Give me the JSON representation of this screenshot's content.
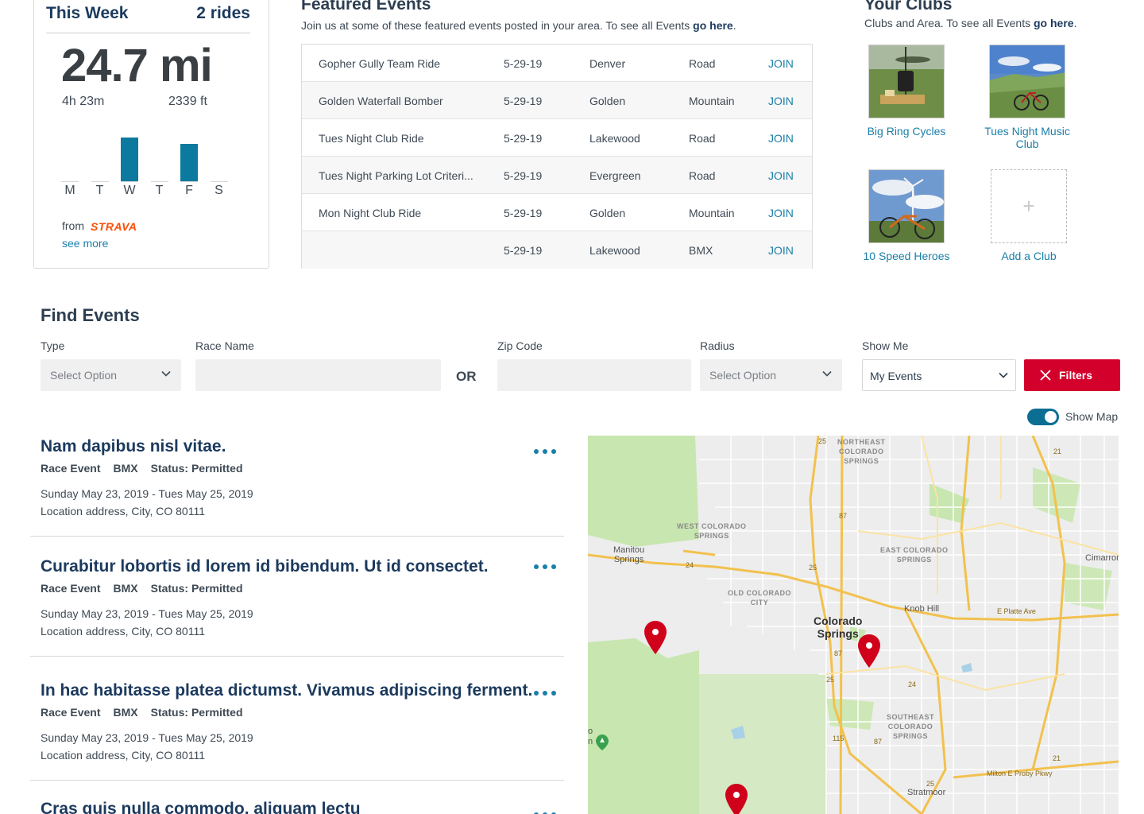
{
  "week": {
    "title": "This Week",
    "rides": "2 rides",
    "distance": "24.7 mi",
    "time": "4h 23m",
    "elevation": "2339 ft",
    "days": [
      {
        "label": "M",
        "level": 0
      },
      {
        "label": "T",
        "level": 0
      },
      {
        "label": "W",
        "level": 1.0
      },
      {
        "label": "T",
        "level": 0
      },
      {
        "label": "F",
        "level": 0.85
      },
      {
        "label": "S",
        "level": 0
      }
    ],
    "from_label": "from",
    "provider": "STRAVA",
    "see_more": "see more"
  },
  "featured": {
    "title": "Featured Events",
    "desc_prefix": "Join us at some of these featured events posted in your area. To see all Events ",
    "desc_link": "go here",
    "desc_suffix": ".",
    "rows": [
      {
        "name": "Gopher Gully Team Ride",
        "date": "5-29-19",
        "city": "Denver",
        "type": "Road",
        "action": "JOIN"
      },
      {
        "name": "Golden Waterfall Bomber",
        "date": "5-29-19",
        "city": "Golden",
        "type": "Mountain",
        "action": "JOIN"
      },
      {
        "name": "Tues Night Club Ride",
        "date": "5-29-19",
        "city": "Lakewood",
        "type": "Road",
        "action": "JOIN"
      },
      {
        "name": "Tues Night Parking Lot Criteri...",
        "date": "5-29-19",
        "city": "Evergreen",
        "type": "Road",
        "action": "JOIN"
      },
      {
        "name": "Mon Night Club Ride",
        "date": "5-29-19",
        "city": "Golden",
        "type": "Mountain",
        "action": "JOIN"
      },
      {
        "name": "",
        "date": "5-29-19",
        "city": "Lakewood",
        "type": "BMX",
        "action": "JOIN"
      }
    ]
  },
  "clubs": {
    "title": "Your Clubs",
    "desc_prefix": "Clubs and Area. To see all Events ",
    "desc_link": "go here",
    "desc_suffix": ".",
    "items": [
      {
        "name": "Big Ring Cycles"
      },
      {
        "name": "Tues Night Music Club"
      },
      {
        "name": "10 Speed Heroes"
      }
    ],
    "add_label": "Add a Club",
    "add_symbol": "+"
  },
  "find": {
    "title": "Find Events",
    "type_label": "Type",
    "type_value": "Select Option",
    "race_label": "Race Name",
    "race_value": "",
    "or_label": "OR",
    "zip_label": "Zip Code",
    "zip_value": "",
    "radius_label": "Radius",
    "radius_value": "Select Option",
    "show_label": "Show Me",
    "show_value": "My Events",
    "filters_label": "Filters",
    "show_map_label": "Show Map"
  },
  "events": [
    {
      "title": "Nam dapibus nisl vitae.",
      "kind": "Race Event",
      "type": "BMX",
      "status": "Status: Permitted",
      "dates": "Sunday May 23, 2019 - Tues May 25, 2019",
      "address": "Location address, City, CO 80111"
    },
    {
      "title": "Curabitur lobortis id lorem id bibendum. Ut id consectet.",
      "kind": "Race Event",
      "type": "BMX",
      "status": "Status: Permitted",
      "dates": "Sunday May 23, 2019 - Tues May 25, 2019",
      "address": "Location address, City, CO 80111"
    },
    {
      "title": "In hac habitasse platea dictumst. Vivamus adipiscing ferment.",
      "kind": "Race Event",
      "type": "BMX",
      "status": "Status: Permitted",
      "dates": "Sunday May 23, 2019 - Tues May 25, 2019",
      "address": "Location address, City, CO 80111"
    },
    {
      "title": "Cras quis nulla commodo, aliquam lectu",
      "kind": "",
      "type": "",
      "status": "",
      "dates": "",
      "address": ""
    }
  ],
  "map": {
    "labels": {
      "ne_cs": "NORTHEAST\nCOLORADO\nSPRINGS",
      "w_cs": "WEST COLORADO\nSPRINGS",
      "e_cs": "EAST COLORADO\nSPRINGS",
      "old_cs": "OLD COLORADO\nCITY",
      "se_cs": "SOUTHEAST\nCOLORADO\nSPRINGS",
      "manitou": "Manitou\nSprings",
      "cs": "Colorado\nSprings",
      "knob": "Knob Hill",
      "cimarron": "Cimarron H",
      "platte": "E Platte Ave",
      "milton": "Milton E Proby Pkwy",
      "stratmoor": "Stratmoor",
      "r25a": "25",
      "r87a": "87",
      "r24a": "24",
      "r25b": "25",
      "r87b": "87",
      "r25c": "25",
      "r24b": "24",
      "r115": "115",
      "r87c": "87",
      "r21a": "21",
      "r21b": "21",
      "r25d": "25",
      "edge_o": "o",
      "edge_n": "n"
    },
    "colors": {
      "pin": "#d0021b",
      "park": "#c8e6b0",
      "road": "#f2c14e"
    }
  }
}
